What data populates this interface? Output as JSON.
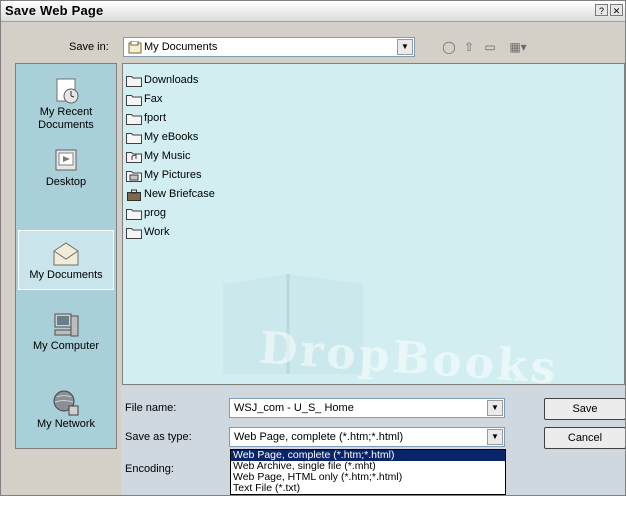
{
  "window": {
    "title": "Save Web Page",
    "help_glyph": "?",
    "close_glyph": "✕"
  },
  "save_in": {
    "label": "Save in:",
    "value": "My Documents",
    "dropdown_glyph": "▼"
  },
  "toolbar": {
    "back_glyph": "◯",
    "up_glyph": "⇧",
    "new_folder_glyph": "▭",
    "views_glyph": "▦▾"
  },
  "places": [
    {
      "label": "My Recent Documents",
      "icon": "clock-document-icon"
    },
    {
      "label": "Desktop",
      "icon": "desktop-icon"
    },
    {
      "label": "My Documents",
      "icon": "envelope-folder-icon"
    },
    {
      "label": "My Computer",
      "icon": "computer-icon"
    },
    {
      "label": "My Network",
      "icon": "network-globe-icon"
    }
  ],
  "files": [
    {
      "name": "Downloads",
      "icon": "folder-icon"
    },
    {
      "name": "Fax",
      "icon": "folder-icon"
    },
    {
      "name": "fport",
      "icon": "folder-icon"
    },
    {
      "name": "My eBooks",
      "icon": "folder-icon"
    },
    {
      "name": "My Music",
      "icon": "music-folder-icon"
    },
    {
      "name": "My Pictures",
      "icon": "pictures-folder-icon"
    },
    {
      "name": "New Briefcase",
      "icon": "briefcase-icon"
    },
    {
      "name": "prog",
      "icon": "folder-icon"
    },
    {
      "name": "Work",
      "icon": "folder-icon"
    }
  ],
  "watermark": "DropBooks",
  "file_name": {
    "label": "File name:",
    "value": "WSJ_com - U_S_ Home"
  },
  "save_as_type": {
    "label": "Save as type:",
    "value": "Web Page, complete (*.htm;*.html)"
  },
  "encoding": {
    "label": "Encoding:"
  },
  "buttons": {
    "save": "Save",
    "cancel": "Cancel"
  },
  "type_options": [
    "Web Page, complete (*.htm;*.html)",
    "Web Archive, single file (*.mht)",
    "Web Page, HTML only (*.htm;*.html)",
    "Text File (*.txt)"
  ],
  "colors": {
    "places_bg": "#a9cfd8",
    "filelist_bg": "#d2eef0",
    "selection": "#0a246a"
  }
}
